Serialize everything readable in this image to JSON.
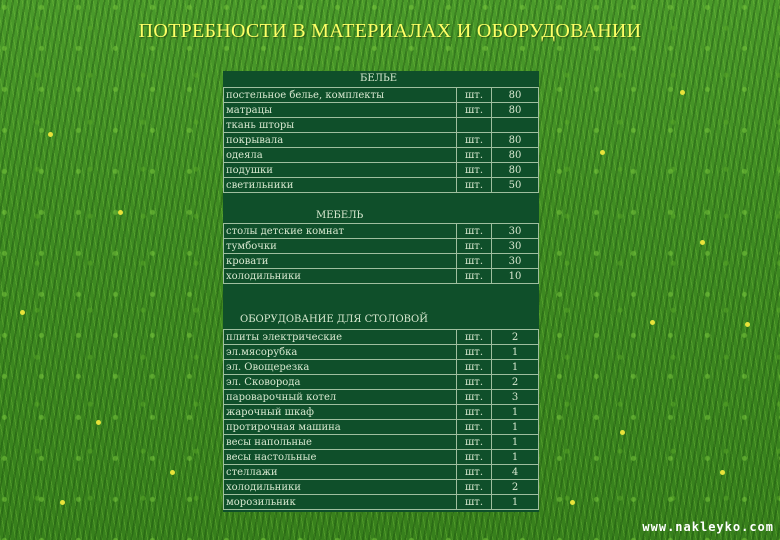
{
  "title": "ПОТРЕБНОСТИ В МАТЕРИАЛАХ И ОБОРУДОВАНИИ",
  "sections": [
    {
      "header": "БЕЛЬЕ",
      "rows": [
        {
          "name": "постельное белье, комплекты",
          "unit": "шт.",
          "qty": "80"
        },
        {
          "name": "матрацы",
          "unit": "шт.",
          "qty": "80"
        },
        {
          "name": "ткань шторы",
          "unit": "",
          "qty": ""
        },
        {
          "name": "покрывала",
          "unit": "шт.",
          "qty": "80"
        },
        {
          "name": "одеяла",
          "unit": "шт.",
          "qty": "80"
        },
        {
          "name": "подушки",
          "unit": "шт.",
          "qty": "80"
        },
        {
          "name": "светильники",
          "unit": "шт.",
          "qty": "50"
        }
      ]
    },
    {
      "header": "МЕБЕЛЬ",
      "rows": [
        {
          "name": "столы детские комнат",
          "unit": "шт.",
          "qty": "30"
        },
        {
          "name": "тумбочки",
          "unit": "шт.",
          "qty": "30"
        },
        {
          "name": "кровати",
          "unit": "шт.",
          "qty": "30"
        },
        {
          "name": "холодильники",
          "unit": "шт.",
          "qty": "10"
        }
      ]
    },
    {
      "header": "ОБОРУДОВАНИЕ ДЛЯ СТОЛОВОЙ",
      "rows": [
        {
          "name": "плиты электрические",
          "unit": "шт.",
          "qty": "2"
        },
        {
          "name": "эл.мясорубка",
          "unit": "шт.",
          "qty": "1"
        },
        {
          "name": "эл. Овощерезка",
          "unit": "шт.",
          "qty": "1"
        },
        {
          "name": "эл. Сковорода",
          "unit": "шт.",
          "qty": "2"
        },
        {
          "name": "пароварочный котел",
          "unit": "шт.",
          "qty": "3"
        },
        {
          "name": "жарочный шкаф",
          "unit": "шт.",
          "qty": "1"
        },
        {
          "name": "протирочная машина",
          "unit": "шт.",
          "qty": "1"
        },
        {
          "name": "весы напольные",
          "unit": "шт.",
          "qty": "1"
        },
        {
          "name": "весы настольные",
          "unit": "шт.",
          "qty": "1"
        },
        {
          "name": "стеллажи",
          "unit": "шт.",
          "qty": "4"
        },
        {
          "name": "холодильники",
          "unit": "шт.",
          "qty": "2"
        },
        {
          "name": "морозильник",
          "unit": "шт.",
          "qty": "1"
        }
      ]
    }
  ],
  "watermark": "www.nakleyko.com"
}
